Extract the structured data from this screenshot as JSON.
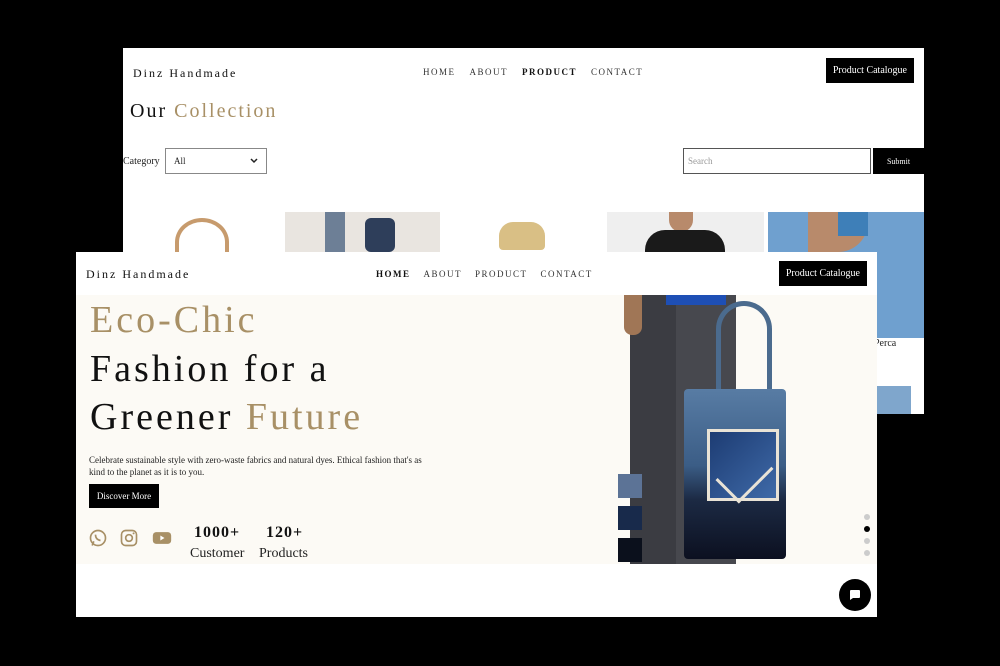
{
  "back_window": {
    "brand": "Dinz Handmade",
    "nav": [
      "HOME",
      "ABOUT",
      "PRODUCT",
      "CONTACT"
    ],
    "nav_active": "PRODUCT",
    "catalogue_button": "Product Catalogue",
    "heading_a": "Our",
    "heading_b": "Collection",
    "category_label": "Category",
    "category_value": "All",
    "search_placeholder": "Search",
    "submit_label": "Submit",
    "partial_product_name": "Perca"
  },
  "front_window": {
    "brand": "Dinz Handmade",
    "nav": [
      "HOME",
      "ABOUT",
      "PRODUCT",
      "CONTACT"
    ],
    "nav_active": "HOME",
    "catalogue_button": "Product Catalogue",
    "hero": {
      "line1": "Eco-Chic",
      "line2": "Fashion for a",
      "line3_a": "Greener",
      "line3_b": "Future",
      "description": "Celebrate sustainable style with zero-waste fabrics and natural dyes. Ethical fashion that's as kind to the planet as it is to you.",
      "cta": "Discover More"
    },
    "social_icons": [
      "whatsapp-icon",
      "instagram-icon",
      "youtube-icon"
    ],
    "stats": [
      {
        "value": "1000+",
        "label": "Customer"
      },
      {
        "value": "120+",
        "label": "Products"
      }
    ],
    "color_swatches": [
      "#5c7396",
      "#182a4b",
      "#0b101c"
    ],
    "carousel": {
      "count": 4,
      "active_index": 1
    },
    "chat_icon": "chat-icon"
  },
  "colors": {
    "accent": "#a89066",
    "dark": "#000000",
    "hero_bg": "#fcfaf5"
  }
}
